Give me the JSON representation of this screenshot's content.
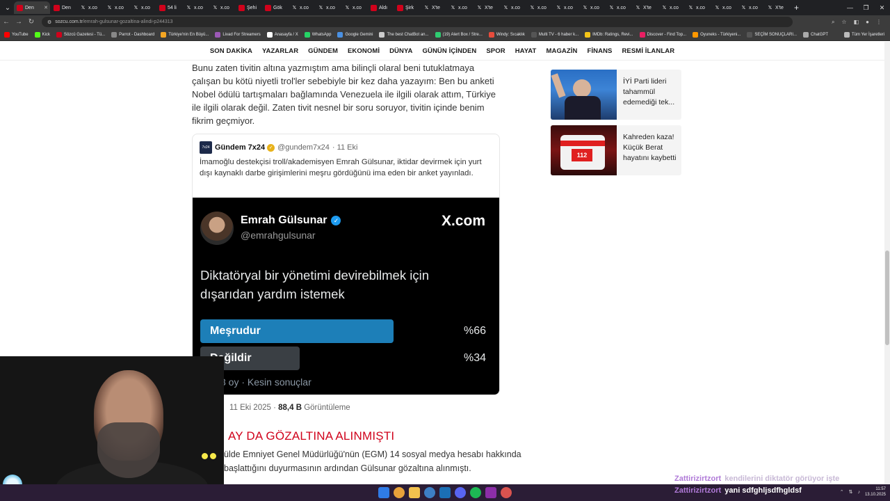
{
  "browser": {
    "tabs": [
      {
        "label": "Den",
        "icon": "red",
        "active": true
      },
      {
        "label": "Den",
        "icon": "red"
      },
      {
        "label": "x.co",
        "icon": "x"
      },
      {
        "label": "x.co",
        "icon": "x"
      },
      {
        "label": "x.co",
        "icon": "x"
      },
      {
        "label": "54 li",
        "icon": "red"
      },
      {
        "label": "x.co",
        "icon": "x"
      },
      {
        "label": "x.co",
        "icon": "x"
      },
      {
        "label": "Şehi",
        "icon": "red"
      },
      {
        "label": "Gök",
        "icon": "red"
      },
      {
        "label": "x.co",
        "icon": "x"
      },
      {
        "label": "x.co",
        "icon": "x"
      },
      {
        "label": "x.co",
        "icon": "x"
      },
      {
        "label": "Aldı",
        "icon": "red"
      },
      {
        "label": "Şirk",
        "icon": "red"
      },
      {
        "label": "X'te",
        "icon": "x"
      },
      {
        "label": "x.co",
        "icon": "x"
      },
      {
        "label": "X'te",
        "icon": "x"
      },
      {
        "label": "x.co",
        "icon": "x"
      },
      {
        "label": "x.co",
        "icon": "x"
      },
      {
        "label": "x.co",
        "icon": "x"
      },
      {
        "label": "x.co",
        "icon": "x"
      },
      {
        "label": "x.co",
        "icon": "x"
      },
      {
        "label": "X'te",
        "icon": "x"
      },
      {
        "label": "x.co",
        "icon": "x"
      },
      {
        "label": "x.co",
        "icon": "x"
      },
      {
        "label": "x.co",
        "icon": "x"
      },
      {
        "label": "x.co",
        "icon": "x"
      },
      {
        "label": "X'te",
        "icon": "x"
      }
    ],
    "url_host": "sozcu.com.tr",
    "url_path": "/emrah-gulsunar-gozaltina-alindi-p244313",
    "bookmarks": [
      {
        "label": "YouTube",
        "color": "#ff0000"
      },
      {
        "label": "Kick",
        "color": "#53fc18"
      },
      {
        "label": "Sözcü Gazetesi - Tü...",
        "color": "#d0021b"
      },
      {
        "label": "Parrot - Dashboard",
        "color": "#888888"
      },
      {
        "label": "Türkiye'nin En Büyü...",
        "color": "#f5a623"
      },
      {
        "label": "Livad For Streamers",
        "color": "#9b59b6"
      },
      {
        "label": "Anasayfa / X",
        "color": "#ffffff"
      },
      {
        "label": "WhatsApp",
        "color": "#25d366"
      },
      {
        "label": "Google Gemini",
        "color": "#4a90e2"
      },
      {
        "label": "The best ChatBot an...",
        "color": "#cccccc"
      },
      {
        "label": "(19) Alert Box / Stre...",
        "color": "#2ecc71"
      },
      {
        "label": "Windy: Sıcaklık",
        "color": "#e74c3c"
      },
      {
        "label": "Multi TV - 6 haber k...",
        "color": "#555555"
      },
      {
        "label": "IMDb: Ratings, Revi...",
        "color": "#f5c518"
      },
      {
        "label": "Discover - Find Top...",
        "color": "#e91e63"
      },
      {
        "label": "Oyuneks - Türkiyeni...",
        "color": "#ff9800"
      },
      {
        "label": "SEÇİM SONUÇLARI...",
        "color": "#555555"
      },
      {
        "label": "ChatGPT",
        "color": "#aaaaaa"
      }
    ],
    "bookmarks_all": "Tüm Yer İşaretleri"
  },
  "nav": [
    "SON DAKİKA",
    "YAZARLAR",
    "GÜNDEM",
    "EKONOMİ",
    "DÜNYA",
    "GÜNÜN İÇİNDEN",
    "SPOR",
    "HAYAT",
    "MAGAZİN",
    "FİNANS",
    "RESMİ İLANLAR"
  ],
  "article": {
    "paragraph1": "Bunu zaten tivitin altına yazmıştım ama bilinçli olaral beni tutuklatmaya çalışan bu kötü niyetli trol'ler sebebiyle bir kez daha yazayım: Ben bu anketi Nobel ödülü tartışmaları bağlamında Venezuela ile ilgili olarak attım, Türkiye ile ilgili olarak değil. Zaten tivit nesnel bir soru soruyor, tivitin içinde benim fikrim geçmiyor.",
    "tweet": {
      "avatar_text": "7x24",
      "name": "Gündem 7x24",
      "handle": "@gundem7x24",
      "date": "· 11 Eki",
      "text": "İmamoğlu destekçisi troll/akademisyen Emrah Gülsunar, iktidar devirmek için yurt dışı kaynaklı darbe girişimlerini meşru gördüğünü ima eden bir anket yayınladı.",
      "poll": {
        "name": "Emrah Gülsunar",
        "handle": "@emrahgulsunar",
        "brand": "X.com",
        "question": "Diktatöryal bir yönetimi devirebilmek için dışarıdan yardım istemek",
        "options": [
          {
            "label": "Meşrudur",
            "percent": "%66",
            "share": 0.66,
            "color": "#1d7fb8"
          },
          {
            "label": "Değildir",
            "percent": "%34",
            "share": 0.34,
            "color": "#3a3f44"
          }
        ],
        "footer": "3 oy · Kesin sonuçlar"
      }
    },
    "tweet_meta_date": "11 Eki 2025 ·",
    "tweet_meta_views": "88,4 B",
    "tweet_meta_views_label": "Görüntüleme",
    "heading": "AY DA GÖZALTINA ALINMIŞTI",
    "paragraph2": "ülde Emniyet Genel Müdürlüğü'nün (EGM) 14 sosyal medya hesabı hakkında başlattığını duyurmasının ardından Gülsunar gözaltına alınmıştı."
  },
  "sidebar": [
    {
      "title": "İYİ Parti lideri tahammül edemediği tek...",
      "thumb": "speech"
    },
    {
      "title": "Kahreden kaza! Küçük Berat hayatını kaybetti",
      "thumb": "ambulance"
    }
  ],
  "chat": [
    {
      "user": "Zattirizirtzort",
      "message": "kendilerini diktatör görüyor işte",
      "faded": true
    },
    {
      "user": "Zattirizirtzort",
      "message": "yani sdfghljsdfhgldsf",
      "faded": false
    }
  ],
  "clock": {
    "time": "11:57",
    "date": "13.10.2025"
  },
  "colors": {
    "accent_red": "#d0021b",
    "taskbar": "#2b1d36",
    "poll_primary": "#1d7fb8"
  }
}
